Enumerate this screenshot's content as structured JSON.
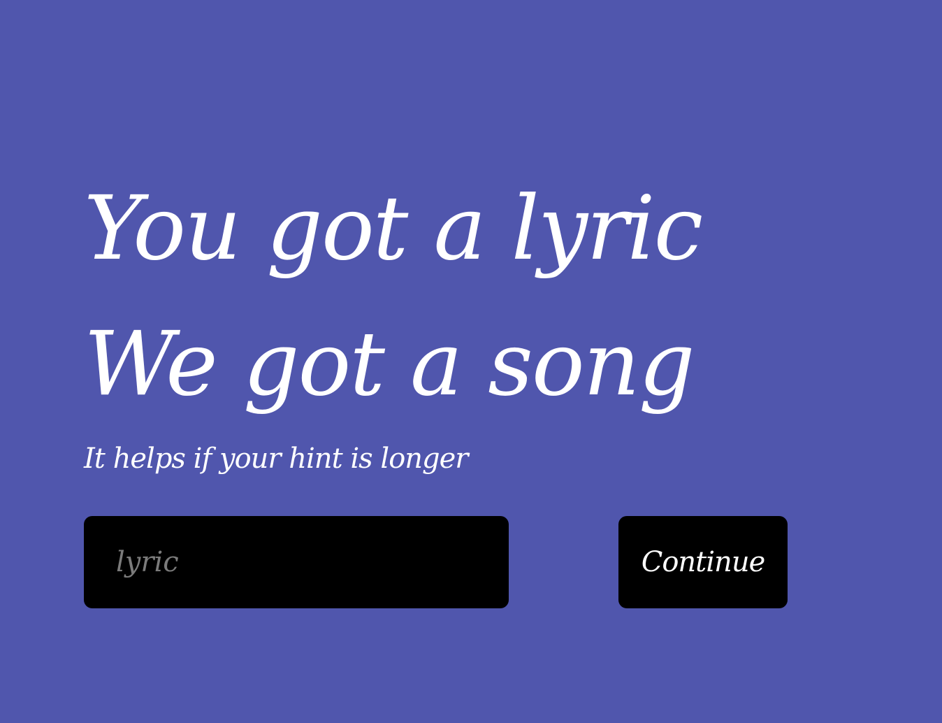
{
  "headline": {
    "line1": "You got a lyric",
    "line2": "We got a song"
  },
  "hint": {
    "text": "It helps if your hint is longer"
  },
  "form": {
    "input": {
      "value": "",
      "placeholder": "lyric"
    },
    "continue_label": "Continue"
  }
}
